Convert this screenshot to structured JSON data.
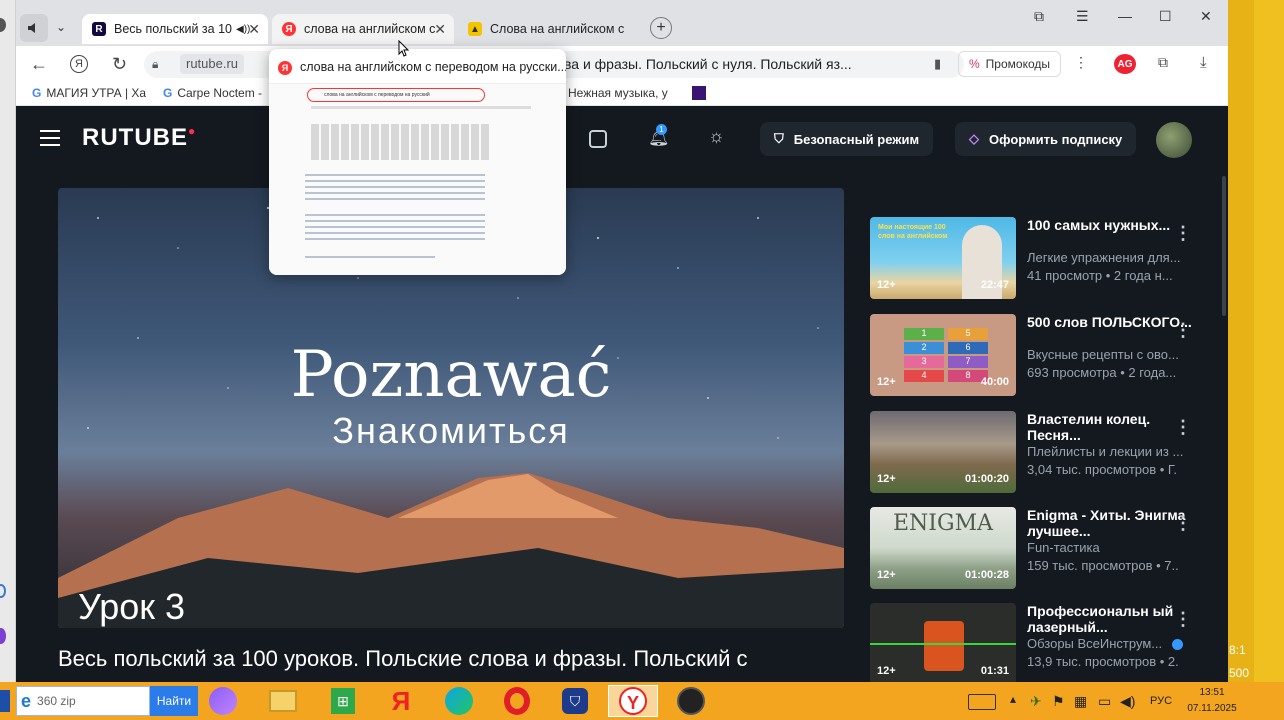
{
  "browser": {
    "tabs": [
      {
        "title": "Весь польский за 10",
        "favicon": "rutube-icon",
        "audio": true
      },
      {
        "title": "слова на английском с",
        "favicon": "yandex-icon"
      },
      {
        "title": "Слова на английском с пе",
        "favicon": "image-icon"
      }
    ],
    "new_tab": "+",
    "address": {
      "domain": "rutube.ru",
      "page_title": "ва и фразы. Польский с нуля. Польский яз..."
    },
    "promo_label": "Промокоды",
    "bookmarks": [
      {
        "label": "МАГИЯ УТРА | Ха"
      },
      {
        "label": "Carpe Noctem -"
      },
      {
        "label": "Нежная музыка, у"
      }
    ],
    "tab_preview": {
      "title": "слова на английском с переводом на русски...",
      "search_text": "слова на английском с переводом на русский"
    }
  },
  "rutube": {
    "logo": "RUTUBE",
    "safe_mode": "Безопасный режим",
    "subscribe": "Оформить подписку",
    "notification_count": "1",
    "hero": {
      "title": "Poznawać",
      "subtitle": "Знакомиться",
      "lesson": "Урок 3"
    },
    "video_title": "Весь польский за 100 уроков. Польские слова и фразы. Польский с",
    "recommendations": [
      {
        "title": "100 самых нужных...",
        "channel": "Легкие упражнения для...",
        "meta": "41 просмотр • 2 года н...",
        "age": "12+",
        "duration": "22:47",
        "thumb_text": "Мои настоящие 100 слов на английском"
      },
      {
        "title": "500 слов ПОЛЬСКОГО...",
        "channel": "Вкусные рецепты с ово...",
        "meta": "693 просмотра • 2 года...",
        "age": "12+",
        "duration": "40:00",
        "thumb_numbers": [
          "1",
          "5",
          "2",
          "6",
          "3",
          "7",
          "4",
          "8"
        ]
      },
      {
        "title": "Властелин колец. Песня...",
        "channel": "Плейлисты и лекции из ...",
        "meta": "3,04 тыс. просмотров • Г.",
        "age": "12+",
        "duration": "01:00:20"
      },
      {
        "title": "Enigma - Хиты. Энигма лучшее...",
        "channel": "Fun-тастика",
        "meta": "159 тыс. просмотров • 7..",
        "age": "12+",
        "duration": "01:00:28",
        "thumb_text": "ENIGMA"
      },
      {
        "title": "Профессиональн ый лазерный...",
        "channel": "Обзоры ВсеИнструм...",
        "meta": "13,9 тыс. просмотров • 2.",
        "age": "12+",
        "duration": "01:31",
        "verified": true
      }
    ]
  },
  "taskbar": {
    "search_placeholder": "360 zip",
    "search_button": "Найти",
    "language": "РУС",
    "time": "13:51",
    "date": "07.11.2025"
  },
  "side_texts": {
    "top": "8:1",
    "bottom": "500"
  }
}
